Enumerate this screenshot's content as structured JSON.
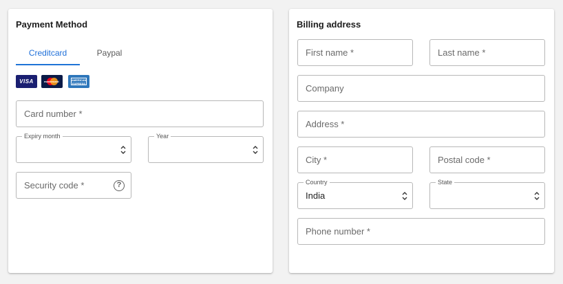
{
  "payment": {
    "title": "Payment Method",
    "tabs": [
      {
        "label": "Creditcard",
        "active": true
      },
      {
        "label": "Paypal",
        "active": false
      }
    ],
    "card_logos": {
      "visa": "VISA",
      "mastercard": "mastercard",
      "amex": "AMERICAN EXPRESS"
    },
    "fields": {
      "card_number": {
        "placeholder": "Card number *"
      },
      "expiry_month": {
        "label": "Expiry month",
        "value": ""
      },
      "year": {
        "label": "Year",
        "value": ""
      },
      "security_code": {
        "placeholder": "Security code *"
      }
    },
    "help_glyph": "?"
  },
  "billing": {
    "title": "Billing address",
    "fields": {
      "first_name": {
        "placeholder": "First name *"
      },
      "last_name": {
        "placeholder": "Last name *"
      },
      "company": {
        "placeholder": "Company"
      },
      "address": {
        "placeholder": "Address *"
      },
      "city": {
        "placeholder": "City *"
      },
      "postal_code": {
        "placeholder": "Postal code *"
      },
      "country": {
        "label": "Country",
        "value": "India"
      },
      "state": {
        "label": "State",
        "value": ""
      },
      "phone": {
        "placeholder": "Phone number *"
      }
    }
  },
  "colors": {
    "accent": "#1e73d6",
    "border": "#b7b7b7",
    "background": "#f2f2f2"
  }
}
